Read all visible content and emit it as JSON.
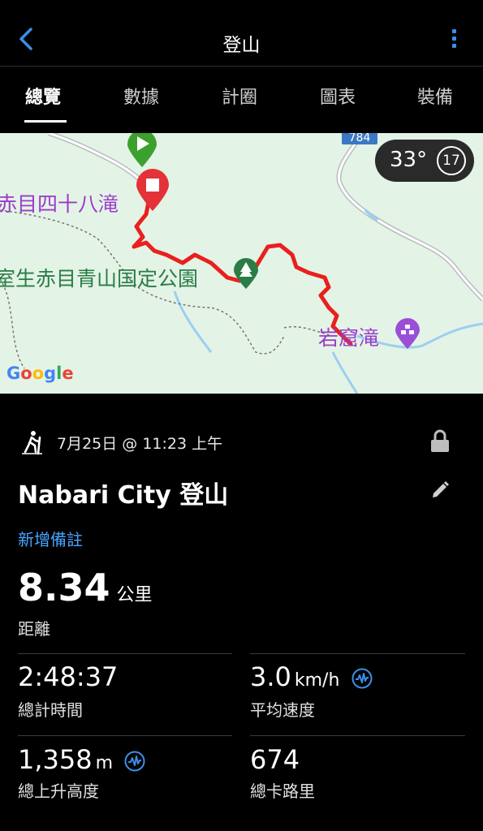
{
  "header": {
    "title": "登山"
  },
  "tabs": [
    {
      "label": "總覽",
      "active": true
    },
    {
      "label": "數據",
      "active": false
    },
    {
      "label": "計圈",
      "active": false
    },
    {
      "label": "圖表",
      "active": false
    },
    {
      "label": "裝備",
      "active": false
    }
  ],
  "map": {
    "road_number": "784",
    "weather_temp": "33°",
    "weather_value": "17",
    "labels": {
      "waterfall_48": "赤目四十八滝",
      "park": "室生赤目青山国定公園",
      "cave_fall": "岩窟滝"
    },
    "attribution": "Google",
    "colors": {
      "route": "#e8201e",
      "start_pin": "#3ba12c",
      "end_pin": "#e33238",
      "water": "#9ccff0"
    }
  },
  "activity": {
    "date_time": "7月25日 @ 11:23 上午",
    "title": "Nabari City 登山",
    "add_note": "新增備註",
    "distance": {
      "value": "8.34",
      "unit": "公里",
      "label": "距離"
    },
    "stats": [
      {
        "value": "2:48:37",
        "unit": "",
        "label": "總計時間"
      },
      {
        "value": "3.0",
        "unit": "km/h",
        "label": "平均速度"
      },
      {
        "value": "1,358",
        "unit": "m",
        "label": "總上升高度"
      },
      {
        "value": "674",
        "unit": "",
        "label": "總卡路里"
      }
    ]
  },
  "icons": [
    "back-arrow-icon",
    "more-vertical-icon",
    "hiking-icon",
    "lock-icon",
    "pencil-icon",
    "performance-wave-icon",
    "play-pin-icon",
    "stop-pin-icon",
    "tree-icon",
    "waterfall-icon"
  ]
}
